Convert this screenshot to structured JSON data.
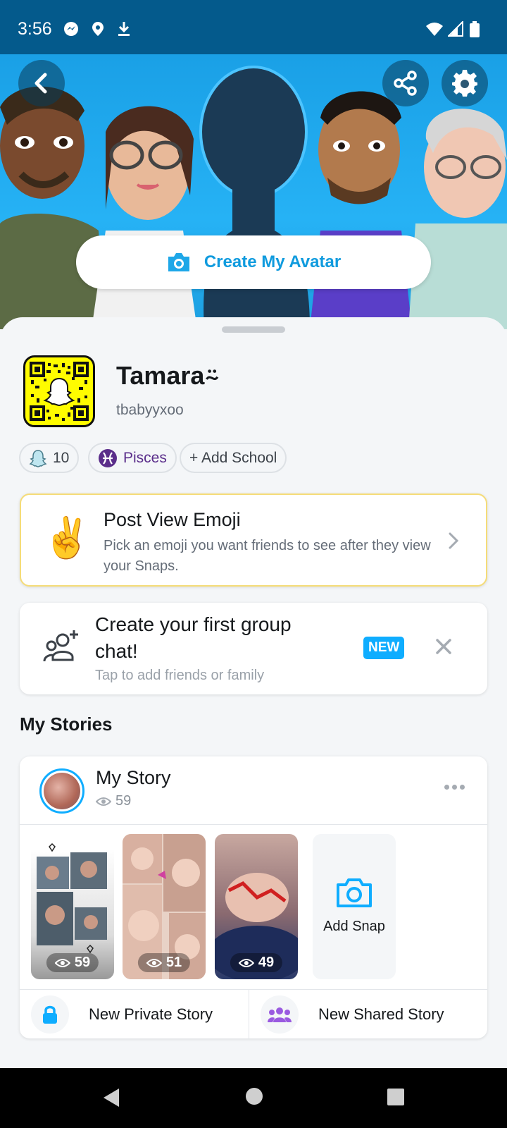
{
  "status_bar": {
    "time": "3:56"
  },
  "hero": {
    "create_avatar_label": "Create My Avatar"
  },
  "profile": {
    "display_name": "Tamara⍨",
    "username": "tbabyyxoo",
    "pills": [
      {
        "icon": "snap-score-icon",
        "label": "10"
      },
      {
        "icon": "pisces-icon",
        "label": "Pisces",
        "color": "#5a2d8a"
      },
      {
        "icon": "",
        "label": "+ Add School"
      }
    ]
  },
  "emoji_card": {
    "emoji": "✌️",
    "title": "Post View Emoji",
    "subtitle": "Pick an emoji you want friends to see after they view your Snaps."
  },
  "group_card": {
    "title": "Create your first group chat!",
    "subtitle": "Tap to add friends or family",
    "badge": "NEW"
  },
  "stories": {
    "heading": "My Stories",
    "my_story": {
      "title": "My Story",
      "views": "59"
    },
    "snaps": [
      {
        "views": "59"
      },
      {
        "views": "51"
      },
      {
        "views": "49"
      }
    ],
    "add_snap_label": "Add Snap",
    "new_private_label": "New Private Story",
    "new_shared_label": "New Shared Story"
  },
  "colors": {
    "accent": "#0fadff",
    "status_bar": "#045a8c",
    "snapcode": "#fffc00"
  }
}
